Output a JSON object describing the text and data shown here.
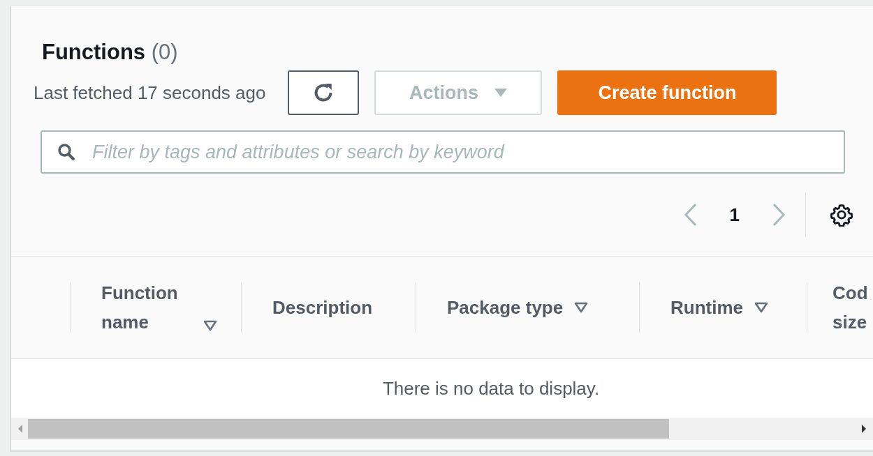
{
  "header": {
    "title": "Functions",
    "count": "(0)"
  },
  "toolbar": {
    "last_fetched": "Last fetched 17 seconds ago",
    "actions": {
      "label": "Actions",
      "disabled": true
    },
    "create_button": "Create function"
  },
  "search": {
    "placeholder": "Filter by tags and attributes or search by keyword"
  },
  "pagination": {
    "page": "1",
    "prev_disabled": true,
    "next_disabled": true
  },
  "table": {
    "columns": [
      {
        "label": "Function name",
        "sortable": true
      },
      {
        "label": "Description",
        "sortable": false
      },
      {
        "label": "Package type",
        "sortable": true
      },
      {
        "label": "Runtime",
        "sortable": true
      },
      {
        "label": "Cod size"
      }
    ],
    "empty_message": "There is no data to display."
  }
}
